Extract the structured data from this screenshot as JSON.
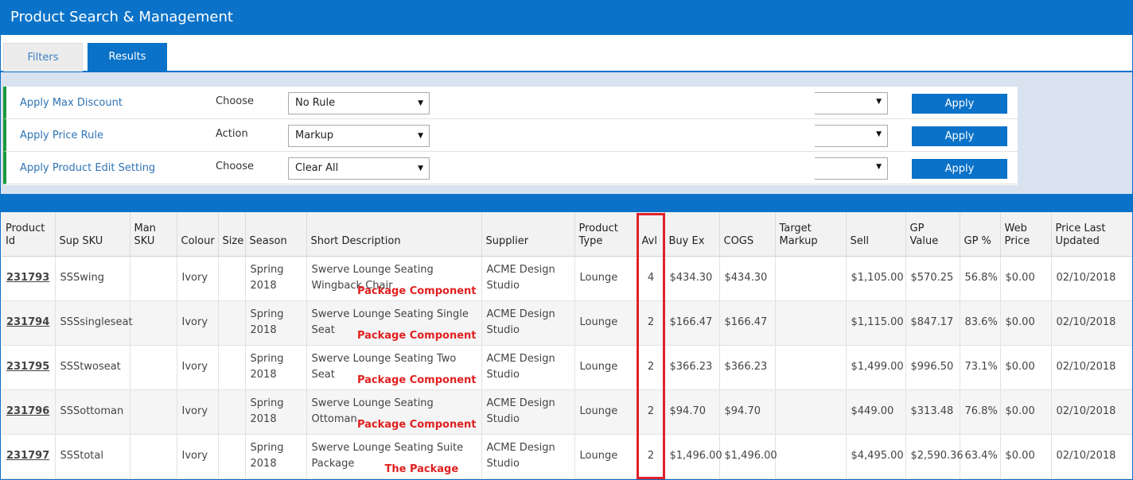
{
  "window": {
    "title": "Product Search & Management"
  },
  "tabs": [
    {
      "label": "Filters",
      "active": false
    },
    {
      "label": "Results",
      "active": true
    }
  ],
  "rules": [
    {
      "name": "Apply Max Discount",
      "sub": "Choose",
      "select": "No Rule",
      "apply": "Apply"
    },
    {
      "name": "Apply Price Rule",
      "sub": "Action",
      "select": "Markup",
      "apply": "Apply"
    },
    {
      "name": "Apply Product Edit Setting",
      "sub": "Choose",
      "select": "Clear All",
      "apply": "Apply"
    }
  ],
  "table": {
    "headers": [
      "Product Id",
      "Sup SKU",
      "Man SKU",
      "Colour",
      "Size",
      "Season",
      "Short Description",
      "Supplier",
      "Product Type",
      "Avl",
      "Buy Ex",
      "COGS",
      "Target Markup",
      "Sell",
      "GP Value",
      "GP %",
      "Web Price",
      "Price Last Updated"
    ],
    "rows": [
      {
        "id": "231793",
        "sup_sku": "SSSwing",
        "man_sku": "",
        "colour": "Ivory",
        "size": "",
        "season": "Spring 2018",
        "desc": "Swerve Lounge Seating Wingback Chair",
        "tag": "Package Component",
        "supplier": "ACME Design Studio",
        "type": "Lounge",
        "avl": "4",
        "buy_ex": "$434.30",
        "cogs": "$434.30",
        "target_markup": "",
        "sell": "$1,105.00",
        "gp_value": "$570.25",
        "gp_pct": "56.8%",
        "web_price": "$0.00",
        "updated": "02/10/2018"
      },
      {
        "id": "231794",
        "sup_sku": "SSSsingleseat",
        "man_sku": "",
        "colour": "Ivory",
        "size": "",
        "season": "Spring 2018",
        "desc": "Swerve Lounge Seating Single Seat",
        "tag": "Package Component",
        "supplier": "ACME Design Studio",
        "type": "Lounge",
        "avl": "2",
        "buy_ex": "$166.47",
        "cogs": "$166.47",
        "target_markup": "",
        "sell": "$1,115.00",
        "gp_value": "$847.17",
        "gp_pct": "83.6%",
        "web_price": "$0.00",
        "updated": "02/10/2018"
      },
      {
        "id": "231795",
        "sup_sku": "SSStwoseat",
        "man_sku": "",
        "colour": "Ivory",
        "size": "",
        "season": "Spring 2018",
        "desc": "Swerve Lounge Seating Two Seat",
        "tag": "Package Component",
        "supplier": "ACME Design Studio",
        "type": "Lounge",
        "avl": "2",
        "buy_ex": "$366.23",
        "cogs": "$366.23",
        "target_markup": "",
        "sell": "$1,499.00",
        "gp_value": "$996.50",
        "gp_pct": "73.1%",
        "web_price": "$0.00",
        "updated": "02/10/2018"
      },
      {
        "id": "231796",
        "sup_sku": "SSSottoman",
        "man_sku": "",
        "colour": "Ivory",
        "size": "",
        "season": "Spring 2018",
        "desc": "Swerve Lounge Seating Ottoman",
        "tag": "Package Component",
        "supplier": "ACME Design Studio",
        "type": "Lounge",
        "avl": "2",
        "buy_ex": "$94.70",
        "cogs": "$94.70",
        "target_markup": "",
        "sell": "$449.00",
        "gp_value": "$313.48",
        "gp_pct": "76.8%",
        "web_price": "$0.00",
        "updated": "02/10/2018"
      },
      {
        "id": "231797",
        "sup_sku": "SSStotal",
        "man_sku": "",
        "colour": "Ivory",
        "size": "",
        "season": "Spring 2018",
        "desc": "Swerve Lounge Seating Suite Package",
        "tag": "The Package",
        "supplier": "ACME Design Studio",
        "type": "Lounge",
        "avl": "2",
        "buy_ex": "$1,496.00",
        "cogs": "$1,496.00",
        "target_markup": "",
        "sell": "$4,495.00",
        "gp_value": "$2,590.36",
        "gp_pct": "63.4%",
        "web_price": "$0.00",
        "updated": "02/10/2018"
      }
    ]
  },
  "colors": {
    "primary": "#0a72c8",
    "rule_accent": "#1a9a3c",
    "highlight": "#e0202a",
    "tag_text": "#e02020",
    "link": "#2e74b5"
  },
  "icons": {
    "dropdown": "chevron-down-icon"
  }
}
